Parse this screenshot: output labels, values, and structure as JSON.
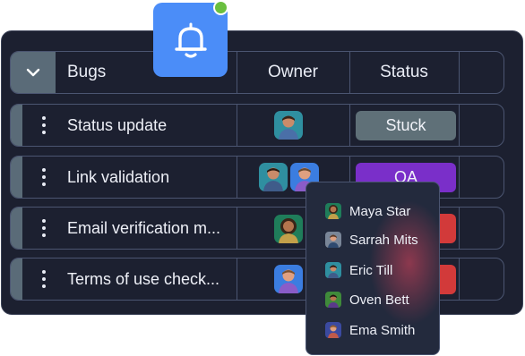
{
  "board": {
    "columns": {
      "title": "Bugs",
      "owner": "Owner",
      "status": "Status"
    },
    "rows": [
      {
        "name": "Status update",
        "status": "Stuck",
        "status_color": "#5f7078"
      },
      {
        "name": "Link validation",
        "status": "QA",
        "status_color": "#7a2fc9"
      },
      {
        "name": "Email verification m...",
        "status": "",
        "status_color": "#d23a3a"
      },
      {
        "name": "Terms of use check...",
        "status": "",
        "status_color": "#d23a3a"
      }
    ]
  },
  "dropdown": {
    "people": [
      "Maya Star",
      "Sarrah Mits",
      "Eric Till",
      "Oven Bett",
      "Ema Smith"
    ]
  },
  "colors": {
    "board_bg": "#1c2030",
    "accent": "#5a6b78",
    "bell": "#4b8df8",
    "notification_dot": "#6abf3f"
  },
  "icons": [
    "bell-icon",
    "chevron-down-icon",
    "drag-handle-icon",
    "avatar-icon"
  ]
}
